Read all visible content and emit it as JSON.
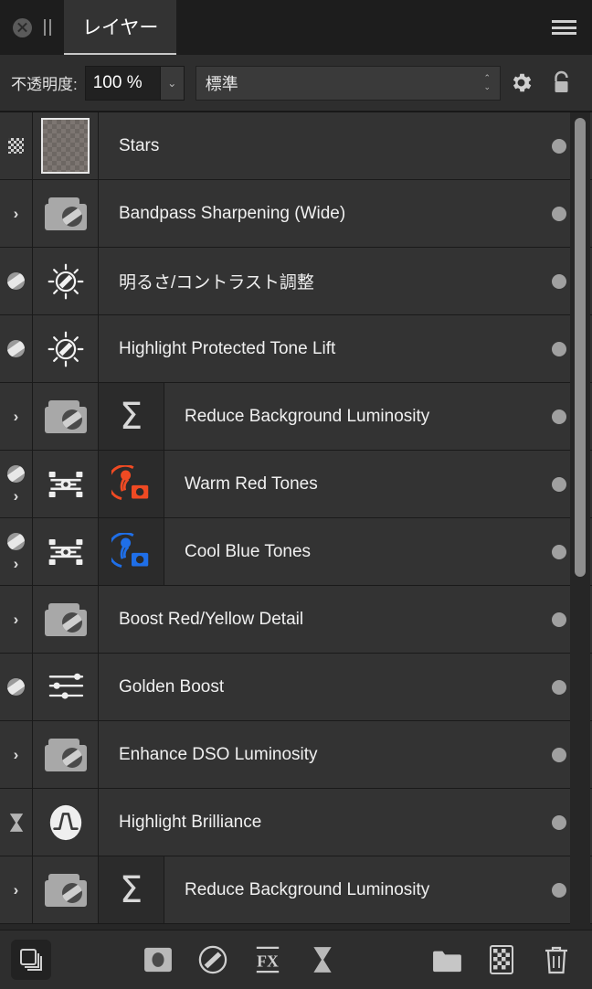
{
  "window": {
    "tab_label": "レイヤー",
    "close_icon": "close-circle-icon",
    "pause_icon": "pause-bars-icon",
    "menu_icon": "hamburger-menu-icon"
  },
  "options": {
    "opacity_label": "不透明度:",
    "opacity_value": "100 %",
    "opacity_dropdown_glyph": "⌄",
    "blend_mode": "標準",
    "blend_spin_up": "⌃",
    "blend_spin_down": "⌄",
    "gear_icon": "gear-icon",
    "lock_icon": "lock-open-icon"
  },
  "colors": {
    "panel_bg": "#2e2e2e",
    "row_bg": "#333333",
    "row_alt_bg": "#2b2b2b",
    "text": "#f0f0f0",
    "accent_red": "#f04a23",
    "accent_blue": "#1f6fe8",
    "dot": "#a0a0a0",
    "scrollbar": "#8e8e8e"
  },
  "layers": [
    {
      "name": "Stars",
      "state_icon": "transparency-checker-icon",
      "thumb": "checkerboard",
      "extra": null,
      "dot": true
    },
    {
      "name": "Bandpass Sharpening (Wide)",
      "state_icon": "chevron-right-icon",
      "thumb": "group-adjustment",
      "extra": null,
      "dot": true
    },
    {
      "name": "明るさ/コントラスト調整",
      "state_icon": "mask-oval-icon",
      "thumb": "brightness-contrast",
      "extra": null,
      "dot": true
    },
    {
      "name": "Highlight Protected Tone Lift",
      "state_icon": "mask-oval-icon",
      "thumb": "brightness-contrast",
      "extra": null,
      "dot": true
    },
    {
      "name": "Reduce Background Luminosity",
      "state_icon": "chevron-right-icon",
      "thumb": "group-adjustment",
      "extra": "sigma",
      "extra_glyph": "Σ",
      "dot": true
    },
    {
      "name": "Warm Red Tones",
      "state_icon": "mask-oval-icon",
      "state_icon2": "chevron-right-icon",
      "thumb": "channel-mixer",
      "extra": "selective-color-red",
      "dot": true
    },
    {
      "name": "Cool Blue Tones",
      "state_icon": "mask-oval-icon",
      "state_icon2": "chevron-right-icon",
      "thumb": "channel-mixer",
      "extra": "selective-color-blue",
      "dot": true
    },
    {
      "name": "Boost Red/Yellow Detail",
      "state_icon": "chevron-right-icon",
      "thumb": "group-adjustment",
      "extra": null,
      "dot": true
    },
    {
      "name": "Golden Boost",
      "state_icon": "mask-oval-icon",
      "thumb": "sliders",
      "extra": null,
      "dot": true
    },
    {
      "name": "Enhance DSO Luminosity",
      "state_icon": "chevron-right-icon",
      "thumb": "group-adjustment",
      "extra": null,
      "dot": true
    },
    {
      "name": "Highlight Brilliance",
      "state_icon": "hourglass-icon",
      "thumb": "curve-circle",
      "extra": null,
      "dot": true
    },
    {
      "name": "Reduce Background Luminosity",
      "state_icon": "chevron-right-icon",
      "thumb": "group-adjustment",
      "extra": "sigma",
      "extra_glyph": "Σ",
      "dot": true
    }
  ],
  "bottom_toolbar": {
    "left": [
      {
        "icon": "layers-stack-icon"
      }
    ],
    "center": [
      {
        "icon": "mask-icon"
      },
      {
        "icon": "adjustment-circle-icon"
      },
      {
        "icon": "fx-icon"
      },
      {
        "icon": "hourglass-icon"
      }
    ],
    "right": [
      {
        "icon": "new-group-folder-icon"
      },
      {
        "icon": "new-pixel-layer-icon"
      },
      {
        "icon": "trash-delete-icon"
      }
    ]
  }
}
